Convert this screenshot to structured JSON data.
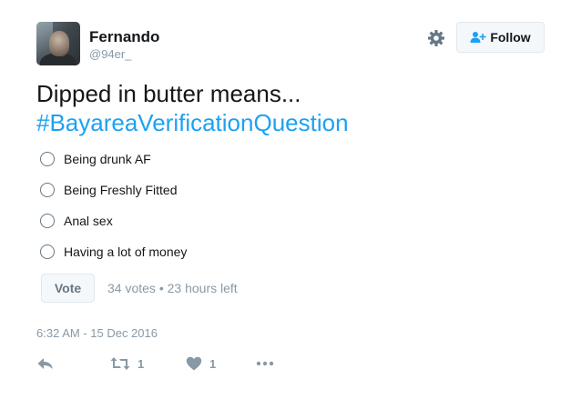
{
  "user": {
    "name": "Fernando",
    "handle": "@94er_"
  },
  "header": {
    "follow_label": "Follow"
  },
  "tweet": {
    "text": "Dipped in butter means...",
    "hashtag": "#BayareaVerificationQuestion"
  },
  "poll": {
    "options": [
      {
        "label": "Being drunk AF"
      },
      {
        "label": "Being Freshly Fitted"
      },
      {
        "label": "Anal sex"
      },
      {
        "label": "Having a lot of money"
      }
    ],
    "vote_label": "Vote",
    "votes": "34 votes",
    "separator": "•",
    "time_left": "23 hours left"
  },
  "timestamp": "6:32 AM - 15 Dec 2016",
  "actions": {
    "retweets": "1",
    "likes": "1"
  },
  "colors": {
    "accent": "#1da1f2",
    "muted": "#8899a6",
    "text": "#14171a"
  }
}
